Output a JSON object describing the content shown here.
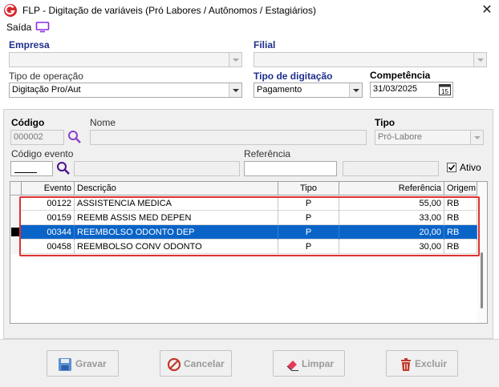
{
  "window": {
    "title": "FLP - Digitação de variáveis (Pró Labores / Autônomos / Estagiários)"
  },
  "menu": {
    "saida": "Saída"
  },
  "empresa": {
    "label": "Empresa",
    "value": ""
  },
  "filial": {
    "label": "Filial",
    "value": ""
  },
  "tipo_operacao": {
    "label": "Tipo de operação",
    "value": "Digitação Pro/Aut"
  },
  "tipo_digitacao": {
    "label": "Tipo de digitação",
    "value": "Pagamento"
  },
  "competencia": {
    "label": "Competência",
    "value": "31/03/2025"
  },
  "codigo": {
    "label": "Código",
    "value": "000002"
  },
  "nome": {
    "label": "Nome",
    "value": ""
  },
  "tipo": {
    "label": "Tipo",
    "value": "Pró-Labore"
  },
  "codigo_evento": {
    "label": "Código evento",
    "value": ""
  },
  "referencia": {
    "label": "Referência",
    "value": ""
  },
  "ativo": {
    "label": "Ativo",
    "checked": true
  },
  "grid": {
    "headers": {
      "evento": "Evento",
      "descricao": "Descrição",
      "tipo": "Tipo",
      "referencia": "Referência",
      "origem": "Origem"
    },
    "rows": [
      {
        "evento": "00122",
        "descricao": "ASSISTENCIA MEDICA",
        "tipo": "P",
        "referencia": "55,00",
        "origem": "RB"
      },
      {
        "evento": "00159",
        "descricao": "REEMB ASSIS MED DEPEN",
        "tipo": "P",
        "referencia": "33,00",
        "origem": "RB"
      },
      {
        "evento": "00344",
        "descricao": "REEMBOLSO ODONTO DEP",
        "tipo": "P",
        "referencia": "20,00",
        "origem": "RB"
      },
      {
        "evento": "00458",
        "descricao": "REEMBOLSO CONV ODONTO",
        "tipo": "P",
        "referencia": "30,00",
        "origem": "RB"
      }
    ],
    "selected_index": 2
  },
  "buttons": {
    "gravar": "Gravar",
    "cancelar": "Cancelar",
    "limpar": "Limpar",
    "excluir": "Excluir"
  },
  "colors": {
    "label_blue": "#1f2f8c",
    "selection": "#0a64c8",
    "highlight": "#e03030"
  }
}
